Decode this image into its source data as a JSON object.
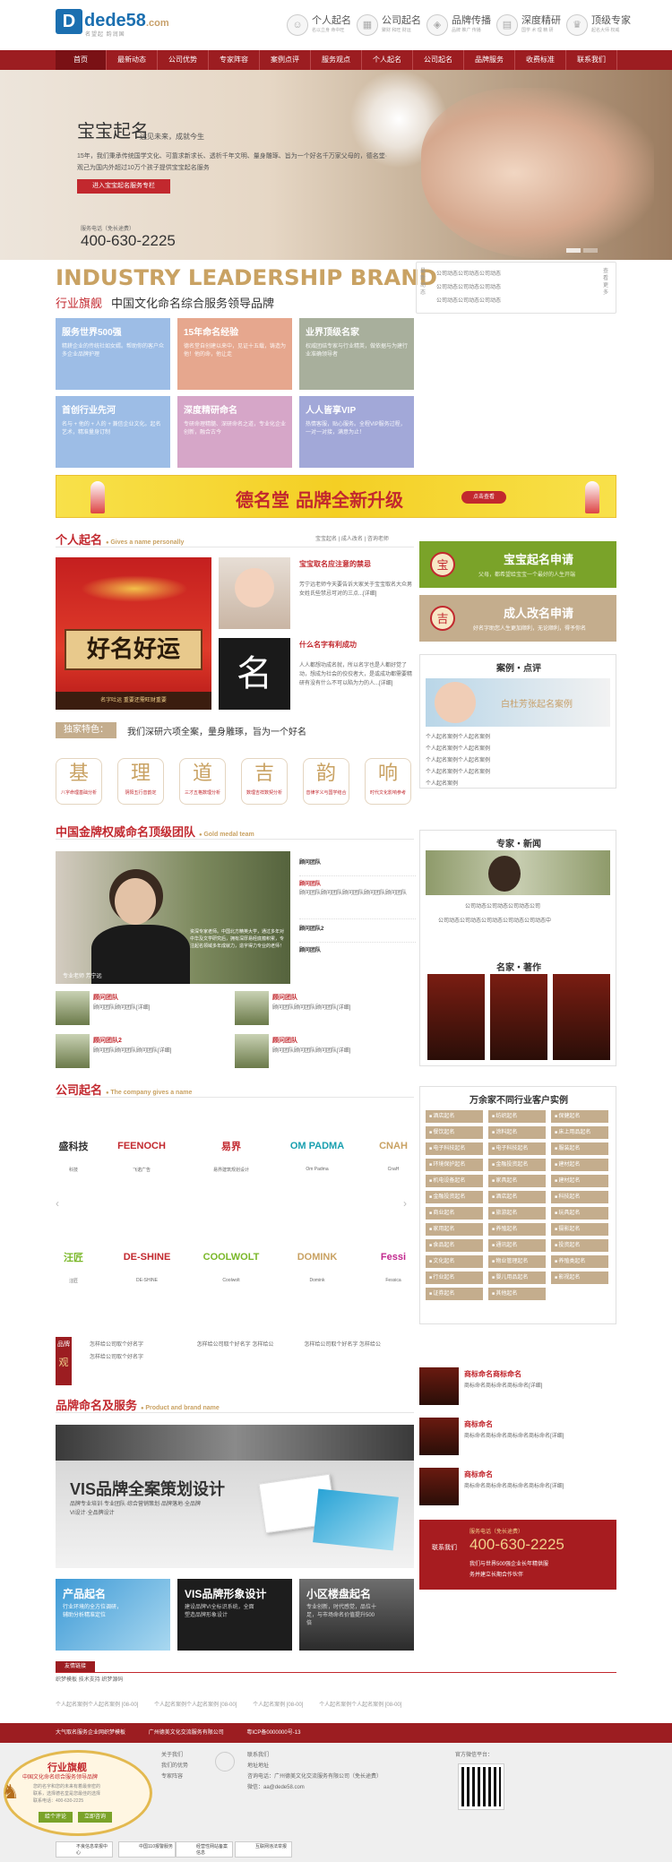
{
  "logo": {
    "mark": "D",
    "name": "dede58",
    "suffix": ".com",
    "slogan": "名望起 韵润国"
  },
  "features": [
    {
      "icon": "baby-icon",
      "title": "个人起名",
      "sub": "名以立身 命中旺"
    },
    {
      "icon": "building-icon",
      "title": "公司起名",
      "sub": "聚财 和旺 财运"
    },
    {
      "icon": "megaphone-icon",
      "title": "品牌传播",
      "sub": "品牌 推广 传播"
    },
    {
      "icon": "book-icon",
      "title": "深度精研",
      "sub": "国学 术 理 精 研"
    },
    {
      "icon": "crown-icon",
      "title": "顶级专家",
      "sub": "起名大师 权威"
    }
  ],
  "nav": [
    "首页",
    "最新动态",
    "公司优势",
    "专家阵容",
    "案例点评",
    "服务观点",
    "个人起名",
    "公司起名",
    "品牌服务",
    "收费标准",
    "联系我们"
  ],
  "banner": {
    "title": "宝宝起名",
    "sub": "远见未来，成就今生",
    "desc": "15年，我们秉承传统国学文化、可靠求新求长、透析千年文明、量身雕琢、旨为一个好名千万家父母的，德名堂·观己为国内外超过10万个孩子提供宝宝起名服务",
    "button": "进入宝宝起名服务专栏",
    "hotline_label": "服务电话（免长途费）",
    "hotline": "400-630-2225"
  },
  "brand": {
    "en": "INDUSTRY LEADERSHIP BRAND",
    "cn1": "行业旗舰",
    "cn2": "中国文化命名综合服务领导品牌"
  },
  "news_box": {
    "left": "最新动态",
    "right": "查看更多",
    "items": [
      "公司动态公司动态公司动态",
      "公司动态公司动态公司动态",
      "公司动态公司动态公司动态"
    ]
  },
  "tiles": [
    {
      "title": "服务世界500强",
      "desc": "精耕企业的传统社如女婿。帮助你的客户众多企业品牌护理",
      "color": "#9dbde6"
    },
    {
      "title": "15年命名经验",
      "desc": "德名堂自创建以来中，见证十五载，铸造为他！他的命，他让走",
      "color": "#e6a78e"
    },
    {
      "title": "业界顶级名家",
      "desc": "权威团结专家与行业精英，做依据与为建行业准确领导者",
      "color": "#a8af9c"
    },
    {
      "title": "首创行业先河",
      "desc": "名与 + 他的 + 人的 + 兼信企业文化。起名艺术，精准量身订制",
      "color": "#9dbde6"
    },
    {
      "title": "深度精研命名",
      "desc": "专研命理精髓、深研命名之道，专业化企业创新，融合古今",
      "color": "#d6a6c8"
    },
    {
      "title": "人人皆享VIP",
      "desc": "热情客服，贴心服务。全程VIP服务过程，一对一对接，满意为止！",
      "color": "#a2a8d8"
    }
  ],
  "ad": {
    "text": "德名堂 品牌全新升级",
    "button": "点击查看"
  },
  "personal": {
    "title": "个人起名",
    "en": "Gives a name personally",
    "links": [
      "宝宝起名",
      "成人改名",
      "咨询老师"
    ],
    "banner_caption": "名字吐运 重要还需旺财重要",
    "banner_text": "好名好运",
    "article1": {
      "title": "宝宝取名应注意的禁忌",
      "body": "芳宁远老师今天要告诉大家关于宝宝取名大众男女姓氏些禁忌可对的三点...[详细]"
    },
    "article2": {
      "title": "什么名字有利成功",
      "body": "人人都想功成名就，所以名字也是人都好觉了动，想成为社会的佼佼者大，是或成功都需要精研有没有什么不可以陷为力的人...[详细]"
    },
    "features_label": "独家特色：",
    "features_text": "我们深研六项全案，量身雕琢，旨为一个好名",
    "six": [
      {
        "glyph": "基",
        "text": "八字命理基础分析"
      },
      {
        "glyph": "理",
        "text": "阴阳五行音韵定"
      },
      {
        "glyph": "道",
        "text": "三才五格数理分析"
      },
      {
        "glyph": "吉",
        "text": "数理吉祥数契分析"
      },
      {
        "glyph": "韵",
        "text": "音律字义与国学结合"
      },
      {
        "glyph": "响",
        "text": "时代文化影响参考"
      }
    ]
  },
  "apply": {
    "baby": {
      "title": "宝宝起名申请",
      "sub": "父母，都希望给宝宝一个最好的人生开端",
      "seal": "宝"
    },
    "adult": {
      "title": "成人改名申请",
      "sub": "好名字助您人生更加顺利，无论顺利，得予你名",
      "seal": "吉"
    }
  },
  "cases": {
    "title": "案例・点评",
    "img_text": "白杜芳张起名案例",
    "items": [
      "个人起名案例个人起名案例",
      "个人起名案例个人起名案例",
      "个人起名案例个人起名案例",
      "个人起名案例个人起名案例",
      "个人起名案例"
    ]
  },
  "team": {
    "title": "中国金牌权威命名顶级团队",
    "en": "Gold medal team",
    "photo_caption": "资深专家老师。中国北方精英大学，通过多年对中华及文学研究后，拥有深厚易经底蕴积累，专注起名领域多年成就力，造字得力专业的老师！",
    "photo_name": "专业老师 芳宁远",
    "list": [
      {
        "title": "顾问团队",
        "body": ""
      },
      {
        "title": "顾问团队",
        "body": "顾问团队顾问团队顾问团队顾问团队顾问团队"
      },
      {
        "title": "顾问团队2",
        "body": ""
      },
      {
        "title": "顾问团队",
        "body": ""
      }
    ],
    "small": [
      {
        "title": "顾问团队",
        "body": "顾问团队顾问团队[详细]"
      },
      {
        "title": "顾问团队",
        "body": "顾问团队顾问团队顾问团队[详细]"
      },
      {
        "title": "顾问团队2",
        "body": "顾问团队顾问团队顾问团队[详细]"
      },
      {
        "title": "顾问团队",
        "body": "顾问团队顾问团队顾问团队[详细]"
      }
    ]
  },
  "expert_news": {
    "title": "专家・新闻",
    "item_title": "公司动态公司动态公司动态公司",
    "item_body": "公司动态公司动态公司动态公司动态公司动态中"
  },
  "famous_works": {
    "title": "名家・著作"
  },
  "company": {
    "title": "公司起名",
    "en": "The company gives a name",
    "logos": [
      {
        "mark": "盛科技",
        "name": "科技",
        "color": "#333"
      },
      {
        "mark": "FEENOCH",
        "name": "飞诺广告",
        "color": "#c2282e"
      },
      {
        "mark": "易界",
        "name": "易界建筑规划设计",
        "color": "#c2282e"
      },
      {
        "mark": "OM PADMA",
        "name": "Om Padma",
        "color": "#1aa0b0"
      },
      {
        "mark": "CNAH",
        "name": "CnaH",
        "color": "#c9a263"
      },
      {
        "mark": "汪匠",
        "name": "汪匠",
        "color": "#7ab829"
      },
      {
        "mark": "DE-SHINE",
        "name": "DE-SHINE",
        "color": "#c2282e"
      },
      {
        "mark": "COOLWOLT",
        "name": "Coolwolt",
        "color": "#7ab829"
      },
      {
        "mark": "DOMINK",
        "name": "Domink",
        "color": "#c9a263"
      },
      {
        "mark": "Fessi",
        "name": "Fessica",
        "color": "#c2288e"
      }
    ]
  },
  "industry": {
    "title": "万余家不同行业客户实例",
    "tags": [
      "酒店起名",
      "纺织起名",
      "保健起名",
      "餐饮起名",
      "涂料起名",
      "床上用品起名",
      "电子科技起名",
      "电子科技起名",
      "服装起名",
      "环境保护起名",
      "金融投资起名",
      "建材起名",
      "机电设备起名",
      "家具起名",
      "建材起名",
      "金融投资起名",
      "酒店起名",
      "科技起名",
      "商业起名",
      "旅游起名",
      "玩具起名",
      "家用起名",
      "养殖起名",
      "摄影起名",
      "食品起名",
      "通讯起名",
      "投资起名",
      "文化起名",
      "物业管理起名",
      "养殖类起名",
      "行业起名",
      "婴儿用品起名",
      "影视起名",
      "证券起名",
      "其他起名"
    ]
  },
  "viewpoint": {
    "label_top": "观",
    "label_sub": "品牌",
    "items": [
      "怎样给公司取个好名字",
      "怎样给公司取个好名字 怎样给公",
      "怎样给公司取个好名字 怎样给公",
      "怎样给公司取个好名字"
    ]
  },
  "trademarks": [
    {
      "title": "商标命名商标命名",
      "body": "商标命名商标命名商标命名[详细]"
    },
    {
      "title": "商标命名",
      "body": "商标命名商标命名商标命名商标命名[详细]"
    },
    {
      "title": "商标命名",
      "body": "商标命名商标命名商标命名商标命名[详细]"
    }
  ],
  "service_box": {
    "label": "服务电话（免长途费）",
    "contact": "联系我们",
    "tel": "400-630-2225",
    "line1": "我们与世界500强企业长年精供服",
    "line2": "务并建立长期合作伙伴"
  },
  "brand_service": {
    "title": "品牌命名及服务",
    "en": "Product and brand name",
    "vis_title": "VIS品牌全案策划设计",
    "vis_body": "品牌专业培训·专业团队·综合营销策划·品牌落地·全品牌VI设计·全品牌设计",
    "tiles": [
      {
        "title": "产品起名",
        "body": "行业环境的全方位调研，辅助分析精准定位"
      },
      {
        "title": "VIS品牌形象设计",
        "body": "建设品牌VI全标识系统，全面塑造品牌形象设计"
      },
      {
        "title": "小区楼盘起名",
        "body": "专业创新，时代感觉，品位十足，与市场命名价值提升500倍"
      }
    ]
  },
  "links": {
    "title": "友情链接",
    "items": [
      "织梦模板",
      "技术支持",
      "织梦源码"
    ]
  },
  "bottom_links": [
    "个人起名案例个人起名案例 [08-00]",
    "个人起名案例个人起名案例 [08-00]",
    "个人起名案例 [08-00]",
    "个人起名案例个人起名案例 [08-00]"
  ],
  "footer": {
    "company1": "大气取名服务企业网织梦模板",
    "company2": "广州德美文化交流服务有限公司",
    "icp": "粤ICP备0000000号-13",
    "col1": [
      "关于我们",
      "我们的优势",
      "专家阵容"
    ],
    "col2": [
      "联系我们",
      "地址地址",
      "咨询电话：广州德美文化交流服务有限公司（免长途费）",
      "微信：aa@dede58.com"
    ],
    "platform": "官方微信平台：",
    "float": {
      "title": "行业旗舰",
      "sub": "中国文化命名综合服务领导品牌",
      "line1": "您的名字和您的未来有着最亲密的",
      "line2": "联系，选择德名堂是您最佳的选择",
      "tel": "联系电话：400-630-2225",
      "btn1": "给个评论",
      "btn2": "立即咨询"
    },
    "badges": [
      {
        "t": "不良信息举报中心"
      },
      {
        "t": "中国110报警服务"
      },
      {
        "t": "经营性网站备案信息"
      },
      {
        "t": "互联网违法举报"
      }
    ]
  }
}
